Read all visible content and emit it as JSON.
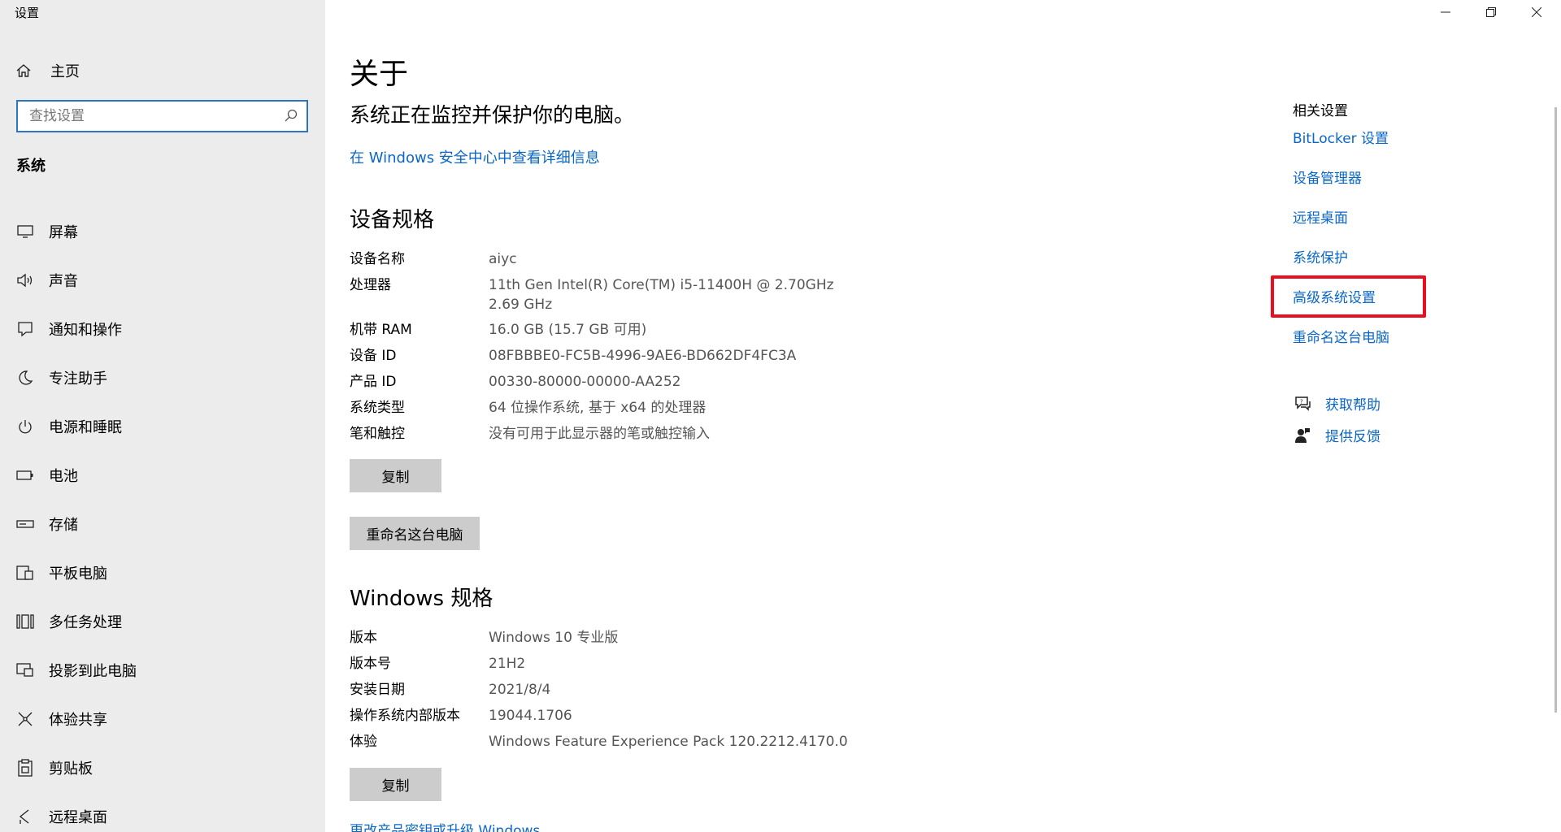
{
  "window": {
    "title": "设置",
    "controls": {
      "minimize_icon": "minimize-icon",
      "restore_icon": "restore-icon",
      "close_icon": "close-icon"
    }
  },
  "sidebar": {
    "home_label": "主页",
    "search_placeholder": "查找设置",
    "section": "系统",
    "items": [
      {
        "label": "屏幕",
        "icon": "monitor-icon"
      },
      {
        "label": "声音",
        "icon": "speaker-icon"
      },
      {
        "label": "通知和操作",
        "icon": "notification-icon"
      },
      {
        "label": "专注助手",
        "icon": "moon-icon"
      },
      {
        "label": "电源和睡眠",
        "icon": "power-icon"
      },
      {
        "label": "电池",
        "icon": "battery-icon"
      },
      {
        "label": "存储",
        "icon": "storage-icon"
      },
      {
        "label": "平板电脑",
        "icon": "tablet-icon"
      },
      {
        "label": "多任务处理",
        "icon": "multitask-icon"
      },
      {
        "label": "投影到此电脑",
        "icon": "project-icon"
      },
      {
        "label": "体验共享",
        "icon": "share-icon"
      },
      {
        "label": "剪贴板",
        "icon": "clipboard-icon"
      },
      {
        "label": "远程桌面",
        "icon": "remote-desktop-icon"
      }
    ]
  },
  "main": {
    "title": "关于",
    "subtitle": "系统正在监控并保护你的电脑。",
    "security_link": "在 Windows 安全中心中查看详细信息",
    "device_specs": {
      "heading": "设备规格",
      "rows": [
        {
          "key": "设备名称",
          "value": "aiyc"
        },
        {
          "key": "处理器",
          "value": "11th Gen Intel(R) Core(TM) i5-11400H @ 2.70GHz\n2.69 GHz"
        },
        {
          "key": "机带 RAM",
          "value": "16.0 GB (15.7 GB 可用)"
        },
        {
          "key": "设备 ID",
          "value": "08FBBBE0-FC5B-4996-9AE6-BD662DF4FC3A"
        },
        {
          "key": "产品 ID",
          "value": "00330-80000-00000-AA252"
        },
        {
          "key": "系统类型",
          "value": "64 位操作系统, 基于 x64 的处理器"
        },
        {
          "key": "笔和触控",
          "value": "没有可用于此显示器的笔或触控输入"
        }
      ],
      "copy_label": "复制",
      "rename_label": "重命名这台电脑"
    },
    "windows_specs": {
      "heading": "Windows 规格",
      "rows": [
        {
          "key": "版本",
          "value": "Windows 10 专业版"
        },
        {
          "key": "版本号",
          "value": "21H2"
        },
        {
          "key": "安装日期",
          "value": "2021/8/4"
        },
        {
          "key": "操作系统内部版本",
          "value": "19044.1706"
        },
        {
          "key": "体验",
          "value": "Windows Feature Experience Pack 120.2212.4170.0"
        }
      ],
      "copy_label": "复制",
      "upgrade_link": "更改产品密钥或升级 Windows"
    }
  },
  "related": {
    "heading": "相关设置",
    "links": [
      "BitLocker 设置",
      "设备管理器",
      "远程桌面",
      "系统保护",
      "高级系统设置",
      "重命名这台电脑"
    ],
    "help_label": "获取帮助",
    "feedback_label": "提供反馈",
    "highlight_color": "#e8101e",
    "link_color": "#0a67c7"
  }
}
